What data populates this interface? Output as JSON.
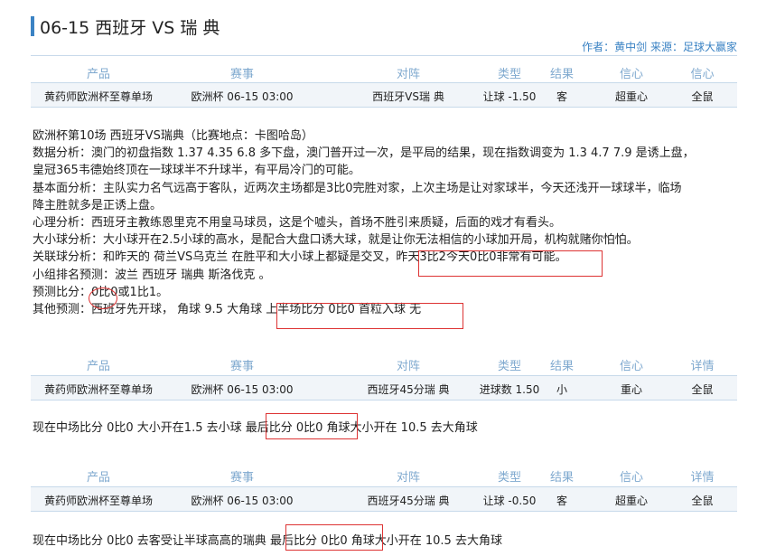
{
  "title": "06-15 西班牙 VS 瑞 典",
  "byline": "作者：黄中剑 来源：足球大赢家",
  "headers": [
    "产品",
    "赛事",
    "对阵",
    "类型",
    "结果",
    "信心",
    "详情"
  ],
  "table1": [
    "黄药师欧洲杯至尊单场",
    "欧洲杯 06-15 03:00",
    "西班牙VS瑞 典",
    "让球 -1.50",
    "客",
    "超重心",
    "全鼠"
  ],
  "analysis": [
    "欧洲杯第10场 西班牙VS瑞典（比赛地点：卡图哈岛）",
    "数据分析：澳门的初盘指数 1.37 4.35 6.8 多下盘，澳门普开过一次，是平局的结果，现在指数调变为 1.3 4.7 7.9 是诱上盘，",
    "皇冠365韦德始终顶在一球球半不升球半，有平局冷门的可能。",
    "基本面分析：主队实力名气远高于客队，近两次主场都是3比0完胜对家，上次主场是让对家球半，今天还浅开一球球半，临场",
    "降主胜就多是正诱上盘。",
    "心理分析：西班牙主教练恩里克不用皇马球员，这是个嘘头，首场不胜引来质疑，后面的戏才有看头。",
    "大小球分析：大小球开在2.5小球的高水，是配合大盘口诱大球，就是让你无法相信的小球加开局，机构就赌你怕怕。",
    "关联球分析：和昨天的 荷兰VS乌克兰 在胜平和大小球上都疑是交叉，昨天3比2今天0比0非常有可能。",
    "小组排名预测：波兰 西班牙 瑞典 斯洛伐克 。",
    "预测比分：0比0或1比1。",
    "其他预测：西班牙先开球， 角球 9.5 大角球 上半场比分 0比0 首粒入球 无"
  ],
  "table2": [
    "黄药师欧洲杯至尊单场",
    "欧洲杯 06-15 03:00",
    "西班牙45分瑞 典",
    "进球数 1.50",
    "小",
    "重心",
    "全鼠"
  ],
  "line2": "现在中场比分 0比0  大小开在1.5  去小球  最后比分 0比0  角球大小开在 10.5  去大角球",
  "table3": [
    "黄药师欧洲杯至尊单场",
    "欧洲杯 06-15 03:00",
    "西班牙45分瑞 典",
    "让球 -0.50",
    "客",
    "超重心",
    "全鼠"
  ],
  "line3": "现在中场比分 0比0  去客受让半球高高的瑞典  最后比分 0比0  角球大小开在 10.5 去大角球"
}
